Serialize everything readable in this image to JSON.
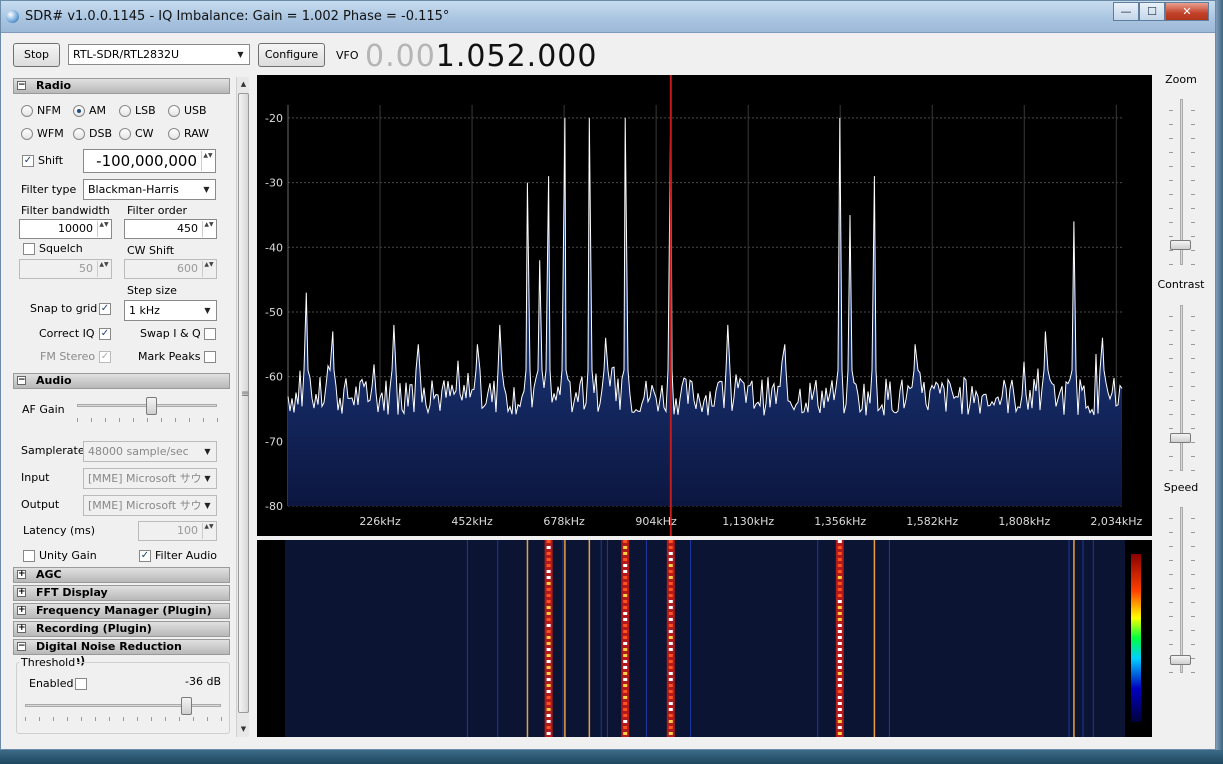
{
  "window": {
    "title": "SDR# v1.0.0.1145 - IQ Imbalance: Gain = 1.002 Phase = -0.115°",
    "minimize_glyph": "—",
    "maximize_glyph": "☐",
    "close_glyph": "✕"
  },
  "toolbar": {
    "stop_label": "Stop",
    "device_value": "RTL-SDR/RTL2832U",
    "configure_label": "Configure",
    "vfo_label": "VFO",
    "vfo_dim": "0.00",
    "vfo_bright": "1.052.000"
  },
  "radio": {
    "header": "Radio",
    "modes": [
      "NFM",
      "AM",
      "LSB",
      "USB",
      "WFM",
      "DSB",
      "CW",
      "RAW"
    ],
    "selected_mode": "AM",
    "shift_label": "Shift",
    "shift_checked": true,
    "shift_value": "-100,000,000",
    "filter_type_label": "Filter type",
    "filter_type_value": "Blackman-Harris",
    "filter_bandwidth_label": "Filter bandwidth",
    "filter_bandwidth_value": "10000",
    "filter_order_label": "Filter order",
    "filter_order_value": "450",
    "squelch_label": "Squelch",
    "squelch_value": "50",
    "cw_shift_label": "CW Shift",
    "cw_shift_value": "600",
    "step_size_label": "Step size",
    "snap_label": "Snap to grid",
    "step_value": "1 kHz",
    "correct_iq_label": "Correct IQ",
    "swap_iq_label": "Swap I & Q",
    "fm_stereo_label": "FM Stereo",
    "mark_peaks_label": "Mark Peaks",
    "check_glyph": "✓"
  },
  "audio": {
    "header": "Audio",
    "af_gain_label": "AF Gain",
    "af_gain_level": 0.53,
    "samplerate_label": "Samplerate",
    "samplerate_value": "48000 sample/sec",
    "input_label": "Input",
    "input_value": "[MME] Microsoft サウ",
    "output_label": "Output",
    "output_value": "[MME] Microsoft サウ",
    "latency_label": "Latency (ms)",
    "latency_value": "100",
    "unity_gain_label": "Unity Gain",
    "filter_audio_label": "Filter Audio"
  },
  "collapsed_sections": {
    "agc": "AGC",
    "fft_display": "FFT Display",
    "frequency_manager": "Frequency Manager (Plugin)",
    "recording": "Recording (Plugin)"
  },
  "noise_reduction": {
    "header": "Digital Noise Reduction (Plugin)",
    "threshold_label": "Threshold",
    "enabled_label": "Enabled",
    "threshold_value": "-36 dB",
    "threshold_level": 0.82
  },
  "right_controls": {
    "zoom_label": "Zoom",
    "zoom_level": 0.12,
    "contrast_label": "Contrast",
    "contrast_level": 0.2,
    "speed_label": "Speed",
    "speed_level": 0.08
  },
  "glyphs": {
    "expand": "+",
    "collapse": "−",
    "dropdown": "▼",
    "spin": "▲▼",
    "scroll_up": "▲",
    "scroll_down": "▼",
    "gripper": "≡"
  },
  "colors": {
    "spectrum_fill": "#1f3f86",
    "spectrum_line": "#ffffff",
    "vfo_marker": "#c21b1b",
    "waterfall_bg": "#0b1433"
  },
  "chart_data": {
    "type": "line",
    "title": "",
    "y_ticks": [
      "-20",
      "-30",
      "-40",
      "-50",
      "-60",
      "-70",
      "-80"
    ],
    "ylim": [
      -80,
      -18
    ],
    "x_ticks": [
      "226kHz",
      "452kHz",
      "678kHz",
      "904kHz",
      "1,130kHz",
      "1,356kHz",
      "1,582kHz",
      "1,808kHz",
      "2,034kHz"
    ],
    "xlim": [
      0,
      2048
    ],
    "noise_floor": -63,
    "vfo_khz": 940,
    "peaks": [
      {
        "x": 45,
        "y": -47
      },
      {
        "x": 110,
        "y": -53
      },
      {
        "x": 260,
        "y": -52
      },
      {
        "x": 320,
        "y": -55
      },
      {
        "x": 465,
        "y": -55
      },
      {
        "x": 520,
        "y": -52
      },
      {
        "x": 588,
        "y": -30
      },
      {
        "x": 618,
        "y": -42
      },
      {
        "x": 640,
        "y": -29
      },
      {
        "x": 680,
        "y": -20
      },
      {
        "x": 740,
        "y": -20
      },
      {
        "x": 780,
        "y": -54
      },
      {
        "x": 828,
        "y": -20
      },
      {
        "x": 940,
        "y": -18
      },
      {
        "x": 1080,
        "y": -52
      },
      {
        "x": 1220,
        "y": -55
      },
      {
        "x": 1355,
        "y": -20
      },
      {
        "x": 1380,
        "y": -35
      },
      {
        "x": 1440,
        "y": -29
      },
      {
        "x": 1540,
        "y": -55
      },
      {
        "x": 1860,
        "y": -53
      },
      {
        "x": 1930,
        "y": -36
      },
      {
        "x": 2000,
        "y": -54
      }
    ],
    "waterfall_strong_khz": [
      640,
      828,
      940,
      1355
    ],
    "waterfall_lines_khz": [
      588,
      680,
      740,
      1440,
      1930
    ]
  }
}
